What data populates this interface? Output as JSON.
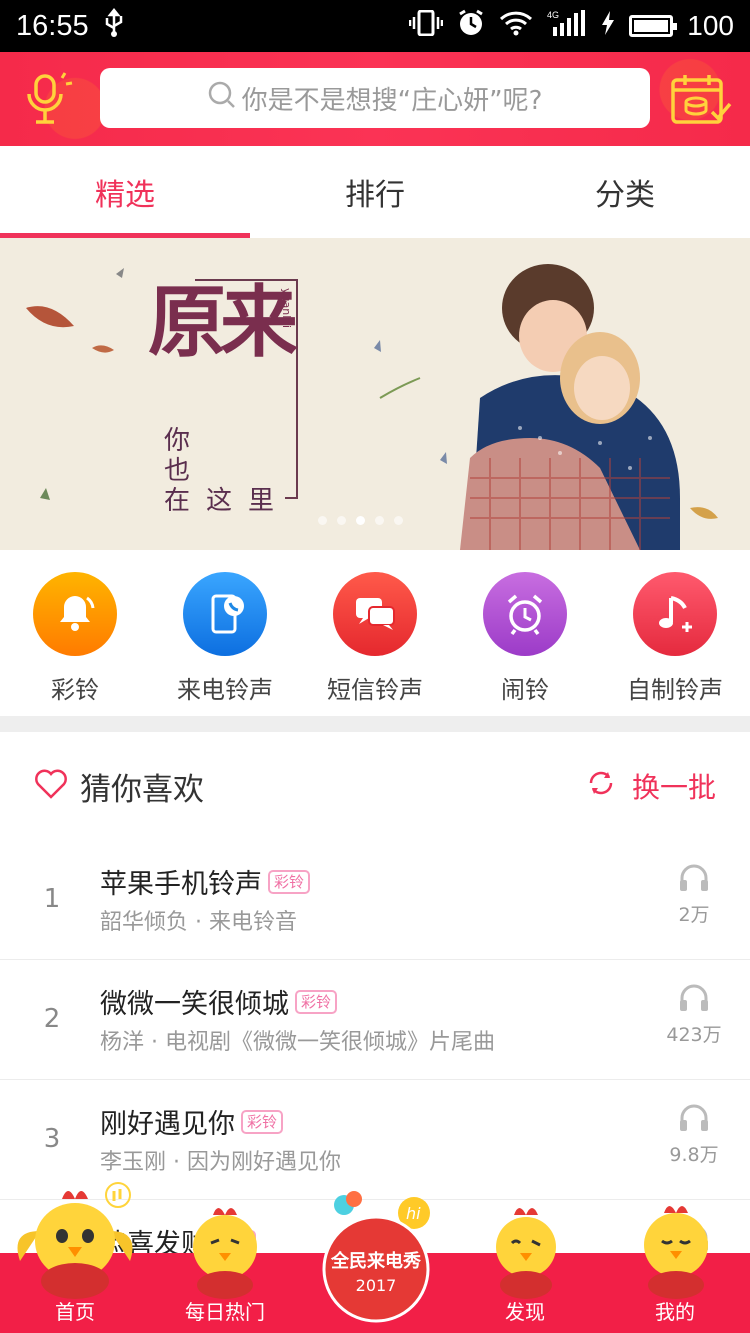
{
  "status_bar": {
    "time": "16:55",
    "battery": "100",
    "network": "4G"
  },
  "search": {
    "placeholder": "你是不是想搜“庄心妍”呢?"
  },
  "tabs": [
    {
      "label": "精选",
      "active": true
    },
    {
      "label": "排行",
      "active": false
    },
    {
      "label": "分类",
      "active": false
    }
  ],
  "banner": {
    "title": "原来",
    "pinyin": "yuanlai",
    "subtitle_cols": [
      "你",
      "也",
      "在",
      "这",
      "里"
    ]
  },
  "categories": [
    {
      "label": "彩铃",
      "icon": "bell-icon",
      "color": "#ff9800"
    },
    {
      "label": "来电铃声",
      "icon": "phone-call-icon",
      "color": "#1e88e5"
    },
    {
      "label": "短信铃声",
      "icon": "message-icon",
      "color": "#f44336"
    },
    {
      "label": "闹铃",
      "icon": "alarm-clock-icon",
      "color": "#ab47bc"
    },
    {
      "label": "自制铃声",
      "icon": "music-note-plus-icon",
      "color": "#f4334f"
    }
  ],
  "recommend": {
    "title": "猜你喜欢",
    "refresh_label": "换一批",
    "badge": "彩铃",
    "items": [
      {
        "rank": "1",
        "title": "苹果手机铃声",
        "subtitle": "韶华倾负 · 来电铃音",
        "plays": "2万"
      },
      {
        "rank": "2",
        "title": "微微一笑很倾城",
        "subtitle": "杨洋 · 电视剧《微微一笑很倾城》片尾曲",
        "plays": "423万"
      },
      {
        "rank": "3",
        "title": "刚好遇见你",
        "subtitle": "李玉刚 · 因为刚好遇见你",
        "plays": "9.8万"
      },
      {
        "rank": "4",
        "title": "恭喜发财",
        "subtitle": "",
        "plays": ""
      }
    ]
  },
  "bottom_nav": [
    {
      "label": "首页",
      "icon": "chick-home-icon"
    },
    {
      "label": "每日热门",
      "icon": "chick-hot-icon"
    },
    {
      "label": "全民来电秀 2017",
      "icon": "center-show-icon"
    },
    {
      "label": "发现",
      "icon": "chick-discover-icon"
    },
    {
      "label": "我的",
      "icon": "chick-mine-icon"
    }
  ],
  "center_badge": {
    "text": "全民来电秀",
    "year": "2017",
    "hi": "hi"
  }
}
